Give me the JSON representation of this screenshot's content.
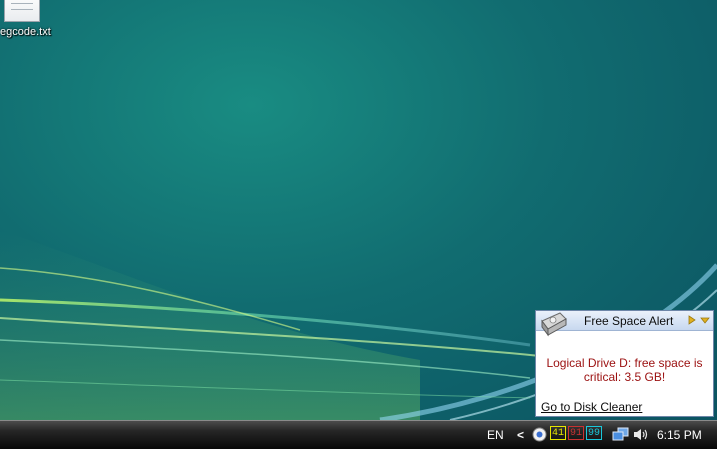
{
  "desktop": {
    "icon_label": "egcode.txt"
  },
  "popup": {
    "title": "Free Space Alert",
    "message": "Logical Drive D: free space is critical: 3.5 GB!",
    "link_label": "Go to Disk Cleaner"
  },
  "taskbar": {
    "language": "EN",
    "chevron": "<",
    "badges": [
      {
        "value": "41",
        "color": "#e6e600"
      },
      {
        "value": "91",
        "color": "#c83232"
      },
      {
        "value": "99",
        "color": "#19c8dc"
      }
    ],
    "clock": "6:15 PM"
  }
}
